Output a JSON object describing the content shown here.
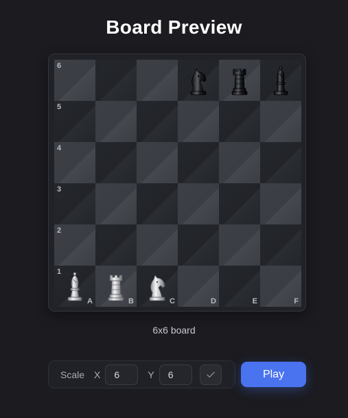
{
  "page": {
    "title": "Board Preview",
    "caption": "6x6 board"
  },
  "board": {
    "size": 6,
    "rank_labels": [
      "6",
      "5",
      "4",
      "3",
      "2",
      "1"
    ],
    "file_labels": [
      "A",
      "B",
      "C",
      "D",
      "E",
      "F"
    ],
    "pieces": [
      {
        "square": "D6",
        "type": "knight",
        "color": "black",
        "icon": "black-knight-icon"
      },
      {
        "square": "E6",
        "type": "rook",
        "color": "black",
        "icon": "black-rook-icon"
      },
      {
        "square": "F6",
        "type": "bishop",
        "color": "black",
        "icon": "black-bishop-icon"
      },
      {
        "square": "A1",
        "type": "bishop",
        "color": "white",
        "icon": "white-bishop-icon"
      },
      {
        "square": "B1",
        "type": "rook",
        "color": "white",
        "icon": "white-rook-icon"
      },
      {
        "square": "C1",
        "type": "knight",
        "color": "white",
        "icon": "white-knight-icon"
      }
    ]
  },
  "controls": {
    "scale_label": "Scale",
    "x_label": "X",
    "x_value": "6",
    "y_label": "Y",
    "y_value": "6",
    "confirm_icon": "check-icon",
    "play_label": "Play"
  },
  "colors": {
    "background": "#1b1b20",
    "light_square": "#3d4046",
    "dark_square": "#24272c",
    "accent": "#4a73f0"
  }
}
